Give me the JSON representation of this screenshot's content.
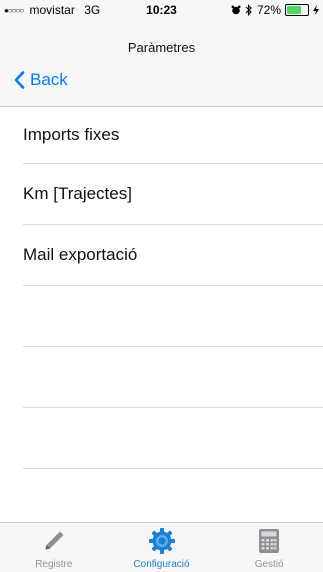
{
  "status_bar": {
    "carrier": "movistar",
    "network": "3G",
    "time": "10:23",
    "battery": "72%",
    "battery_level": 0.72,
    "signal_dots": "●○○○○"
  },
  "nav": {
    "title": "Paràmetres",
    "back_label": "Back",
    "accent_color": "#007aff"
  },
  "list": {
    "items": [
      {
        "label": "Imports fixes"
      },
      {
        "label": "Km [Trajectes]"
      },
      {
        "label": "Mail exportació"
      }
    ]
  },
  "tabbar": {
    "tabs": [
      {
        "label": "Registre",
        "icon": "pencil-icon"
      },
      {
        "label": "Configuració",
        "icon": "gear-icon",
        "active": true
      },
      {
        "label": "Gestió",
        "icon": "calculator-icon"
      }
    ],
    "active_color": "#1a7fd6"
  }
}
